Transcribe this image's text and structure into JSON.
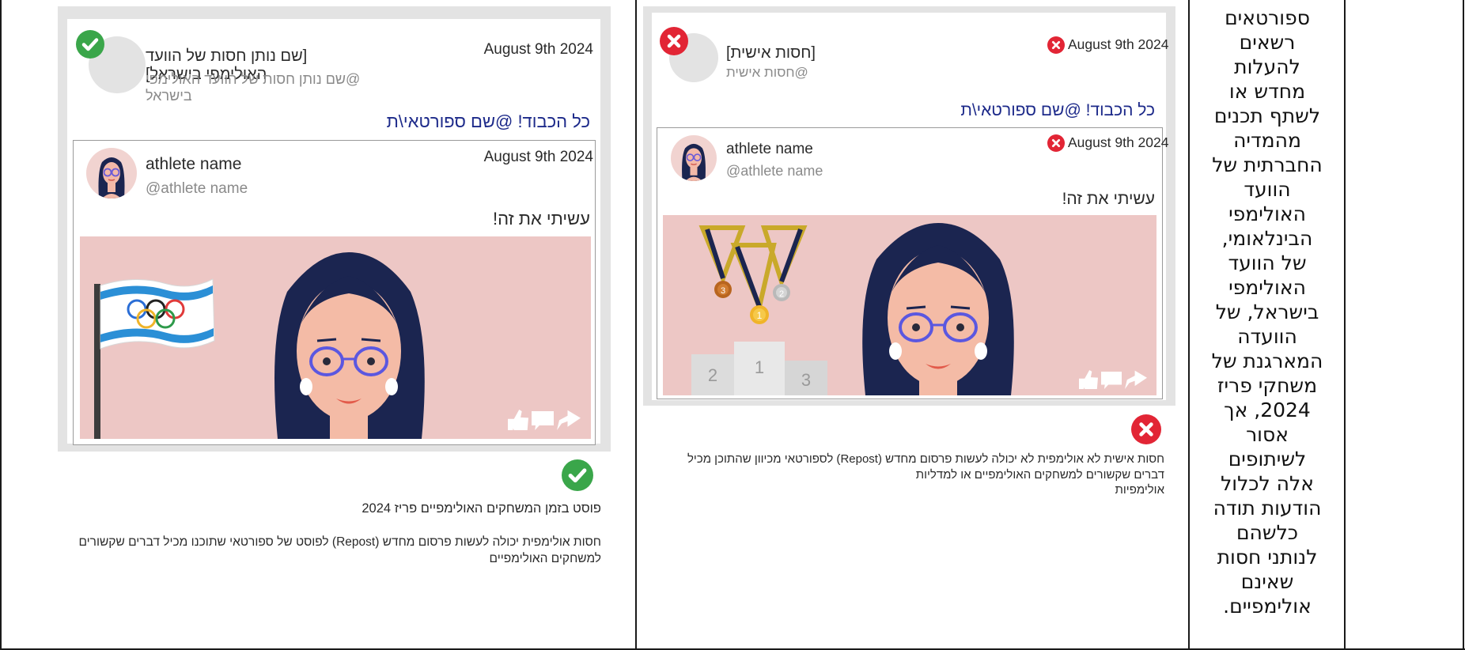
{
  "panel_left": {
    "status": "allowed",
    "header": {
      "name": "[שם נותן חסות של הוועד האולימפי בישראל]",
      "handle": "@שם נותן חסות של הוועד האולימפי בישראל",
      "date": "August 9th 2024",
      "message": "כל הכבוד! @שם ספורטאי\\ת"
    },
    "embed": {
      "name": "athlete name",
      "handle": "@athlete name",
      "date": "August 9th 2024",
      "text": "עשיתי את זה!"
    },
    "caption_title": "פוסט בזמן המשחקים האולימפיים פריז 2024",
    "caption_line1": "חסות אולימפית יכולה לעשות פרסום מחדש (Repost) לפוסט של ספורטאי שתוכנו מכיל דברים שקשורים",
    "caption_line2": "למשחקים האולימפיים"
  },
  "panel_right": {
    "status": "forbidden",
    "header": {
      "name": "[חסות אישית]",
      "handle": "@חסות אישית",
      "date": "August 9th 2024",
      "message": "כל הכבוד! @שם ספורטאי\\ת"
    },
    "embed": {
      "name": "athlete name",
      "handle": "@athlete name",
      "date": "August 9th 2024",
      "text": "עשיתי את זה!"
    },
    "podium": {
      "first": "1",
      "second": "2",
      "third": "3"
    },
    "medals": {
      "gold": "1",
      "silver": "2",
      "bronze": "3"
    },
    "caption_line1": "חסות אישית לא אולימפית לא יכולה לעשות פרסום מחדש (Repost) לספורטאי מכיוון שהתוכן מכיל",
    "caption_line2": "דברים שקשורים למשחקים האולימפיים או למדליות אולימפיות"
  },
  "rule_text": [
    "ספורטאים",
    "רשאים",
    "להעלות",
    "מחדש או",
    "לשתף תכנים",
    "מהמדיה",
    "החברתית של",
    "הוועד",
    "האולימפי",
    "הבינלאומי,",
    "של הוועד",
    "האולימפי",
    "בישראל, של",
    "הוועדה",
    "המארגנת של",
    "משחקי פריז",
    "2024, אך",
    "אסור",
    "לשיתופים",
    "אלה לכלול",
    "הודעות תודה",
    "כלשהם",
    "לנותני חסות",
    "שאינם",
    "אולימפיים."
  ],
  "colors": {
    "allowed": "#3aa64a",
    "forbidden": "#e22535",
    "link": "#1d2a8a",
    "scene_bg": "#edc7c5",
    "panel_bg": "#e3e3e3"
  },
  "icons": [
    "check-icon",
    "x-icon",
    "like-icon",
    "comment-icon",
    "share-icon",
    "olympic-rings-icon",
    "medal-icon",
    "podium-icon"
  ]
}
